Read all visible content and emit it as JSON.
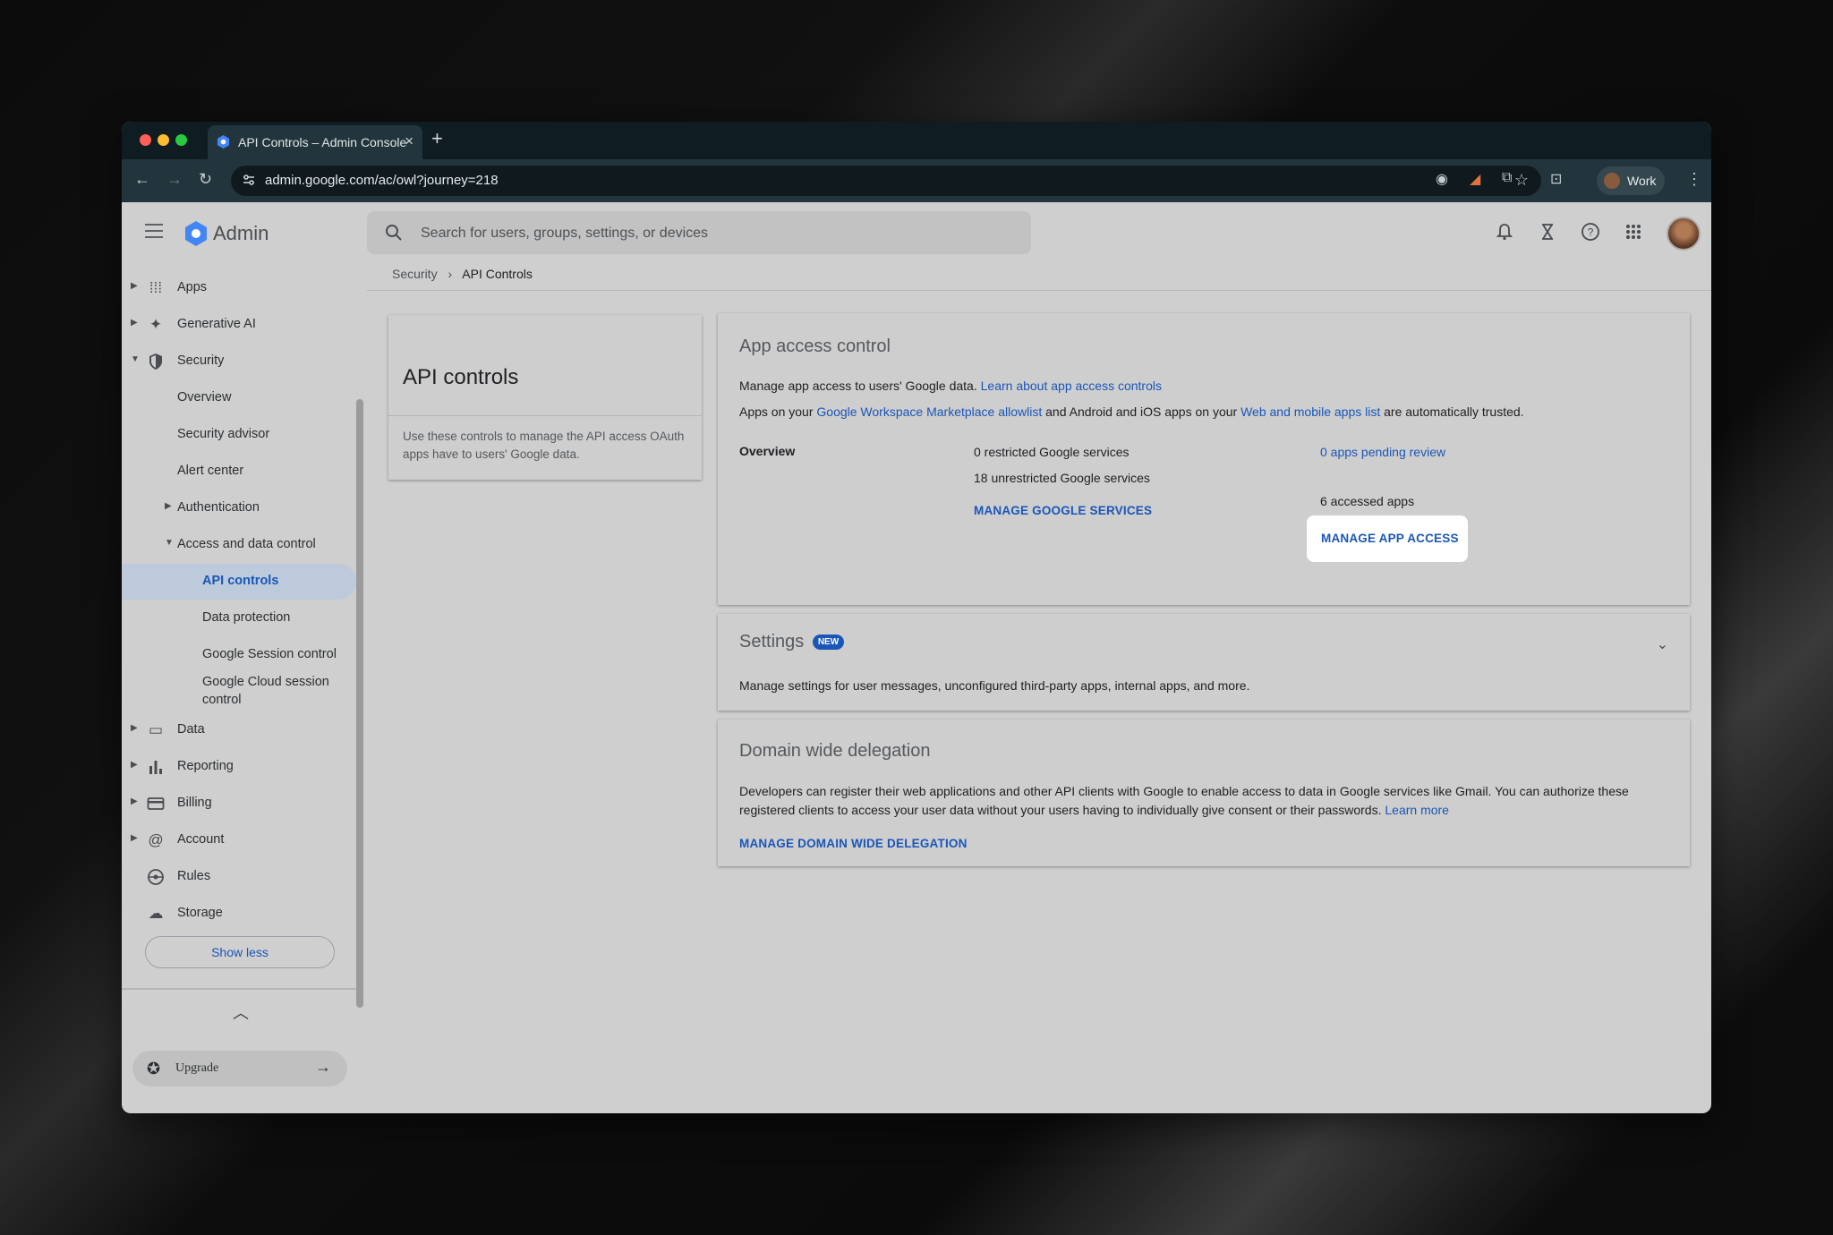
{
  "browser": {
    "tab_title": "API Controls – Admin Console",
    "new_tab": "+",
    "url": "admin.google.com/ac/owl?journey=218",
    "profile_label": "Work"
  },
  "app": {
    "name": "Admin",
    "search_placeholder": "Search for users, groups, settings, or devices"
  },
  "breadcrumb": {
    "parent": "Security",
    "separator": "›",
    "current": "API Controls"
  },
  "sidebar": {
    "items": [
      {
        "label": "Apps"
      },
      {
        "label": "Generative AI"
      },
      {
        "label": "Security"
      },
      {
        "label": "Overview"
      },
      {
        "label": "Security advisor"
      },
      {
        "label": "Alert center"
      },
      {
        "label": "Authentication"
      },
      {
        "label": "Access and data control"
      },
      {
        "label": "API controls"
      },
      {
        "label": "Data protection"
      },
      {
        "label": "Google Session control"
      },
      {
        "label": "Google Cloud session control"
      },
      {
        "label": "Data"
      },
      {
        "label": "Reporting"
      },
      {
        "label": "Billing"
      },
      {
        "label": "Account"
      },
      {
        "label": "Rules"
      },
      {
        "label": "Storage"
      }
    ],
    "show_less": "Show less",
    "upgrade": "Upgrade"
  },
  "info_card": {
    "title": "API controls",
    "description": "Use these controls to manage the API access OAuth apps have to users' Google data."
  },
  "app_access": {
    "title": "App access control",
    "line1_prefix": "Manage app access to users' Google data.",
    "line1_link": "Learn about app access controls",
    "line2_a": "Apps on your",
    "line2_link1": "Google Workspace Marketplace allowlist",
    "line2_b": "and Android and iOS apps on your",
    "line2_link2": "Web and mobile apps list",
    "line2_c": "are automatically trusted.",
    "overview_label": "Overview",
    "restricted": "0 restricted Google services",
    "unrestricted": "18 unrestricted Google services",
    "manage_services": "MANAGE GOOGLE SERVICES",
    "pending": "0 apps pending review",
    "accessed": "6 accessed apps",
    "manage_app_access": "MANAGE APP ACCESS"
  },
  "settings_card": {
    "title": "Settings",
    "badge": "NEW",
    "description": "Manage settings for user messages, unconfigured third-party apps, internal apps, and more."
  },
  "delegation": {
    "title": "Domain wide delegation",
    "line1": "Developers can register their web applications and other API clients with Google to enable access to data in Google services like Gmail. You can authorize these",
    "line2": "registered clients to access your user data without your users having to individually give consent or their passwords.",
    "learn_more": "Learn more",
    "manage": "MANAGE DOMAIN WIDE DELEGATION"
  },
  "colors": {
    "accent": "#1a56b8",
    "page_bg": "#cfcfcf",
    "chrome_dark": "#23353c"
  }
}
